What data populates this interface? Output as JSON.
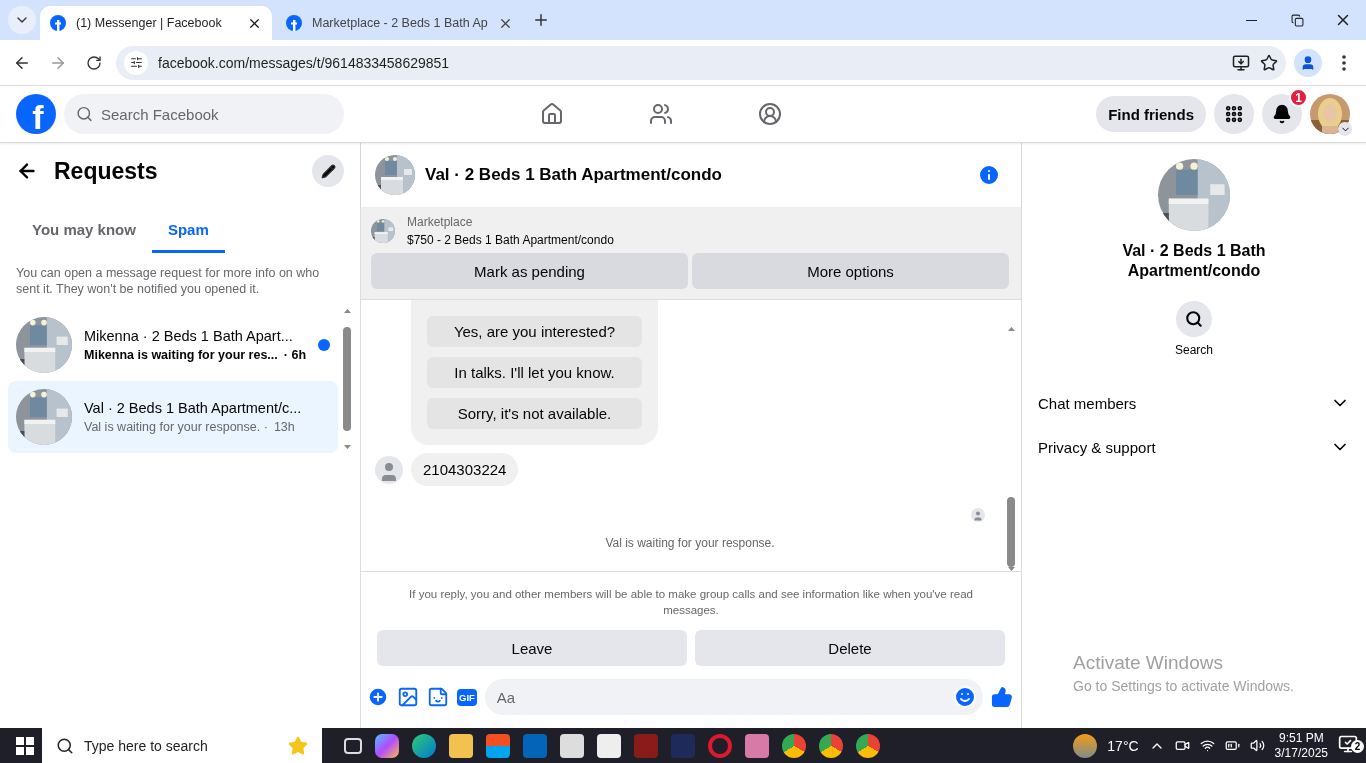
{
  "browser": {
    "tabs": [
      {
        "title": "(1) Messenger | Facebook",
        "selected": true
      },
      {
        "title": "Marketplace - 2 Beds 1 Bath Ap",
        "selected": false
      }
    ],
    "url": "facebook.com/messages/t/9614833458629851"
  },
  "facebook": {
    "logo_letter": "f",
    "search_placeholder": "Search Facebook",
    "find_friends": "Find friends",
    "notification_count": "1"
  },
  "requests": {
    "title": "Requests",
    "tabs": [
      {
        "label": "You may know",
        "selected": false
      },
      {
        "label": "Spam",
        "selected": true
      }
    ],
    "info": "You can open a message request for more info on who sent it. They won't be notified you opened it.",
    "conversations": [
      {
        "name": "Mikenna · 2 Beds 1 Bath Apart...",
        "preview": "Mikenna is waiting for your res...",
        "time": "· 6h",
        "unread": true,
        "selected": false
      },
      {
        "name": "Val · 2 Beds 1 Bath Apartment/c...",
        "preview": "Val is waiting for your response. ·",
        "time": "13h",
        "unread": false,
        "selected": true
      }
    ]
  },
  "chat": {
    "title": "Val · 2 Beds 1 Bath Apartment/condo",
    "listing": {
      "label": "Marketplace",
      "title": "$750 - 2 Beds 1 Bath Apartment/condo"
    },
    "listing_actions": [
      "Mark as pending",
      "More options"
    ],
    "quick_replies": [
      "Yes, are you interested?",
      "In talks. I'll let you know.",
      "Sorry, it's not available."
    ],
    "message": "2104303224",
    "status": "Val is waiting for your response.",
    "notice": "If you reply, you and other members will be able to make group calls and see information like when you've read messages.",
    "actions": [
      "Leave",
      "Delete"
    ],
    "gif_label": "GIF",
    "composer_placeholder": "Aa"
  },
  "details": {
    "name": "Val · 2 Beds 1 Bath Apartment/condo",
    "search_label": "Search",
    "sections": [
      {
        "label": "Chat members",
        "expanded": false
      },
      {
        "label": "Privacy & support",
        "expanded": false
      }
    ]
  },
  "activation_notice": {
    "title": "Activate Windows",
    "subtitle": "Go to Settings to activate Windows."
  },
  "taskbar": {
    "search_placeholder": "Type here to search",
    "weather": "17°C",
    "time": "9:51 PM",
    "date": "3/17/2025",
    "notification_count": "2"
  }
}
